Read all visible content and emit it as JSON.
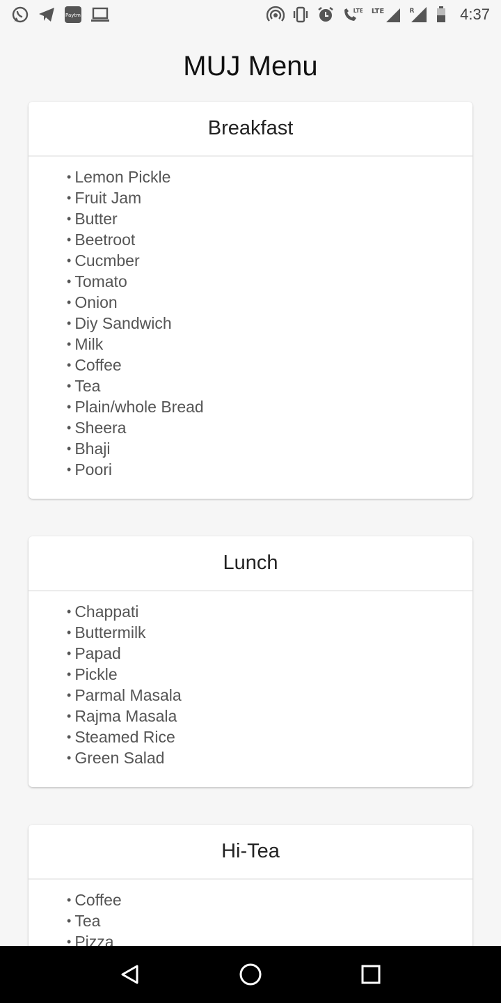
{
  "status_bar": {
    "time": "4:37",
    "left_icons": [
      "whatsapp-icon",
      "telegram-icon",
      "paytm-icon",
      "laptop-icon"
    ],
    "right_icons": [
      "hotspot-icon",
      "vibrate-icon",
      "alarm-icon",
      "volte-call-icon",
      "lte-signal-icon",
      "roaming-signal-icon",
      "battery-icon"
    ],
    "paytm_label": "Paytm",
    "lte_label_1": "LTE",
    "lte_label_2": "LTE",
    "roaming_label": "R"
  },
  "page": {
    "title": "MUJ Menu"
  },
  "menus": [
    {
      "heading": "Breakfast",
      "items": [
        "Lemon Pickle",
        "Fruit Jam",
        "Butter",
        "Beetroot",
        "Cucmber",
        "Tomato",
        "Onion",
        "Diy Sandwich",
        "Milk",
        "Coffee",
        "Tea",
        "Plain/whole Bread",
        "Sheera",
        "Bhaji",
        "Poori"
      ]
    },
    {
      "heading": "Lunch",
      "items": [
        "Chappati",
        "Buttermilk",
        "Papad",
        "Pickle",
        "Parmal Masala",
        "Rajma Masala",
        "Steamed Rice",
        "Green Salad"
      ]
    },
    {
      "heading": "Hi-Tea",
      "items": [
        "Coffee",
        "Tea",
        "Pizza"
      ]
    }
  ],
  "bullet": "•",
  "nav_bar": {
    "buttons": [
      "back-icon",
      "home-icon",
      "recents-icon"
    ]
  }
}
